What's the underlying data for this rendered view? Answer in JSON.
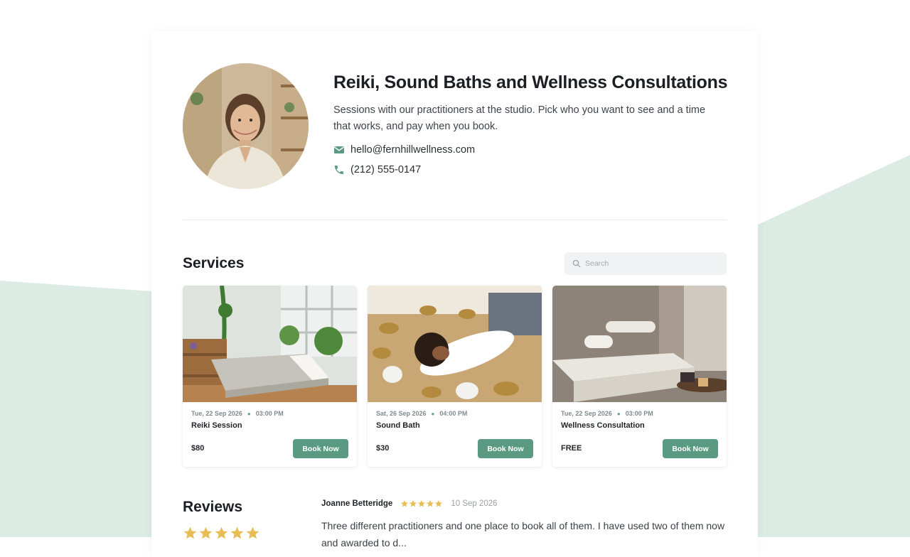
{
  "header": {
    "title": "Reiki, Sound Baths and Wellness Consultations",
    "description": "Sessions with our practitioners at the studio. Pick who you want to see and a time that works, and pay when you book.",
    "email": "hello@fernhillwellness.com",
    "phone": "(212) 555-0147",
    "avatar_icon": "practitioner-portrait"
  },
  "services": {
    "heading": "Services",
    "search_placeholder": "Search",
    "items": [
      {
        "date": "Tue, 22 Sep 2026",
        "time": "03:00 PM",
        "name": "Reiki Session",
        "price": "$80",
        "button": "Book Now"
      },
      {
        "date": "Sat, 26 Sep 2026",
        "time": "04:00 PM",
        "name": "Sound Bath",
        "price": "$30",
        "button": "Book Now"
      },
      {
        "date": "Tue, 22 Sep 2026",
        "time": "03:00 PM",
        "name": "Wellness Consultation",
        "price": "FREE",
        "button": "Book Now"
      }
    ]
  },
  "reviews": {
    "heading": "Reviews",
    "average_rating": 5,
    "items": [
      {
        "author": "Joanne Betteridge",
        "rating": 5,
        "date": "10 Sep 2026",
        "text": "Three different practitioners and one place to book all of them. I have used two of them now and awarded to d..."
      }
    ]
  },
  "colors": {
    "accent": "#5b9a82",
    "background_shape": "#dcebe4",
    "star": "#e8bd55"
  }
}
